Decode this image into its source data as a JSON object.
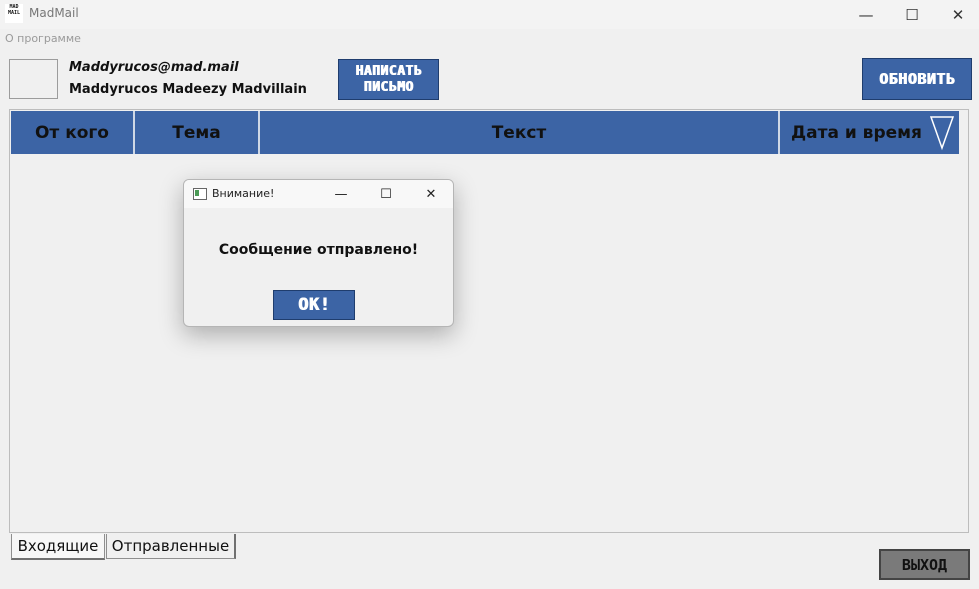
{
  "window": {
    "title": "MadMail",
    "logo_text": "MAD MAIL",
    "minimize_glyph": "—",
    "maximize_glyph": "☐",
    "close_glyph": "✕"
  },
  "menu": {
    "about": "О программе"
  },
  "user": {
    "email": "Maddyrucos@mad.mail",
    "full_name": "Maddyrucos Madeezy Madvillain"
  },
  "toolbar": {
    "write_line1": "НАПИСАТЬ",
    "write_line2": "ПИСЬМО",
    "refresh": "ОБНОВИТЬ"
  },
  "table": {
    "columns": [
      "От кого",
      "Тема",
      "Текст",
      "Дата и время"
    ],
    "rows": []
  },
  "tabs": {
    "inbox": "Входящие",
    "sent": "Отправленные",
    "active": "Входящие"
  },
  "exit_button": "ВЫХОД",
  "dialog": {
    "title": "Внимание!",
    "message": "Сообщение отправлено!",
    "ok": "ОК!",
    "minimize_glyph": "—",
    "maximize_glyph": "☐",
    "close_glyph": "✕"
  },
  "colors": {
    "accent": "#3c64a5",
    "background": "#f0f0f0",
    "exit_button": "#7a7a7a"
  }
}
